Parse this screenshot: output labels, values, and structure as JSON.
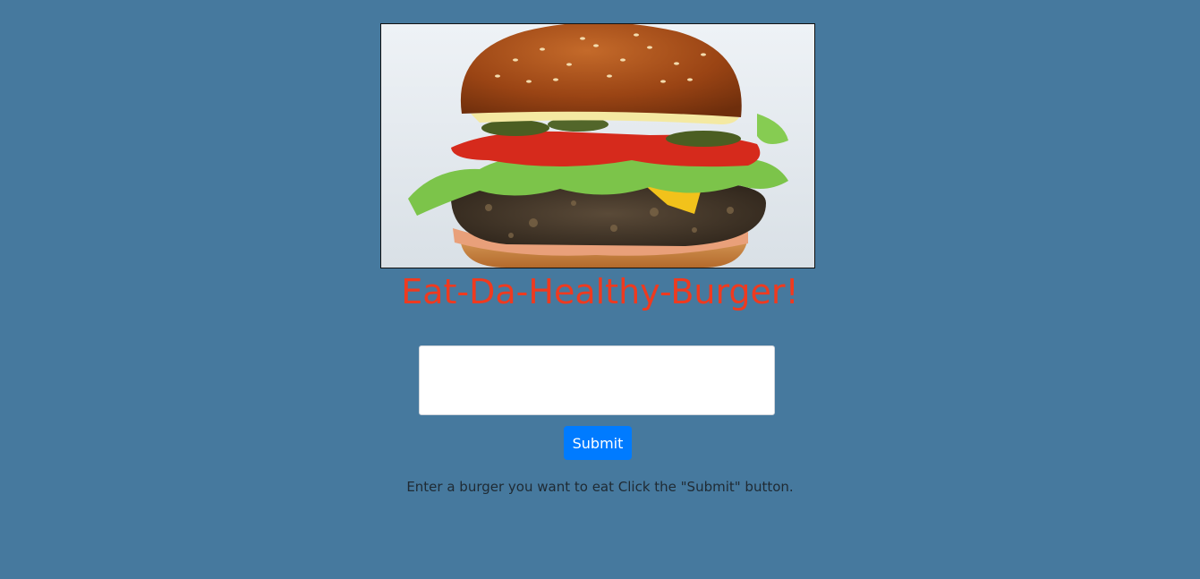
{
  "header": {
    "image_alt": "burger photo",
    "title": "Eat-Da-Healthy-Burger!"
  },
  "form": {
    "input_value": "",
    "submit_label": "Submit",
    "hint": "Enter a burger you want to eat Click the \"Submit\" button."
  },
  "colors": {
    "background": "#46799e",
    "title": "#ef3a1f",
    "button": "#007bff"
  }
}
